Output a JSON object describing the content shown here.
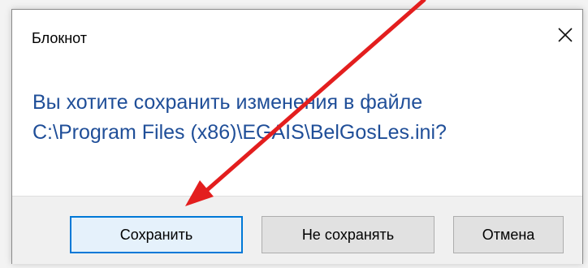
{
  "window": {
    "title": "Блокнот"
  },
  "message": {
    "line1": "Вы хотите сохранить изменения в файле",
    "line2": "C:\\Program Files (x86)\\EGAIS\\BelGosLes.ini?"
  },
  "buttons": {
    "save_label": "Сохранить",
    "dont_save_label": "Не сохранять",
    "cancel_label": "Отмена"
  },
  "icons": {
    "close": "close-icon",
    "annotation": "arrow-annotation"
  },
  "colors": {
    "message_text": "#1f4e98",
    "default_button_border": "#0078d7",
    "annotation_arrow": "#e31e1e"
  }
}
